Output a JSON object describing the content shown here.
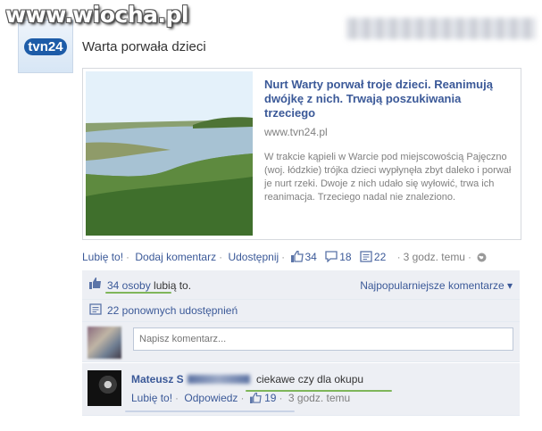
{
  "watermark": "www.wiocha.pl",
  "page": {
    "logo_text": "tvn24"
  },
  "post": {
    "title": "Warta porwała dzieci"
  },
  "share": {
    "headline": "Nurt Warty porwał troje dzieci. Reanimują dwójkę z nich. Trwają poszukiwania trzeciego",
    "domain": "www.tvn24.pl",
    "description": "W trakcie kąpieli w Warcie pod miejscowością Pajęczno (woj. łódzkie) trójka dzieci wypłynęła zbyt daleko i porwał je nurt rzeki. Dwoje z nich udało się wyłowić, trwa ich reanimacja. Trzeciego nadal nie znaleziono."
  },
  "actions": {
    "like": "Lubię to!",
    "comment": "Dodaj komentarz",
    "share": "Udostępnij",
    "likes_count": "34",
    "comments_count": "18",
    "shares_count": "22",
    "time": "3 godz. temu"
  },
  "ufi": {
    "likes_link": "34 osoby",
    "likes_suffix": " lubią to.",
    "sort_label": "Najpopularniejsze komentarze ▾",
    "reshares": "22 ponownych udostępnień",
    "comment_placeholder": "Napisz komentarz..."
  },
  "comment": {
    "author": "Mateusz S",
    "text": "ciekawe czy dla okupu",
    "like": "Lubię to!",
    "reply": "Odpowiedz",
    "likes": "19",
    "time": "3 godz. temu"
  },
  "colors": {
    "link": "#3b5998",
    "ufi_bg": "#edeff4",
    "highlight": "#7fb65a"
  }
}
